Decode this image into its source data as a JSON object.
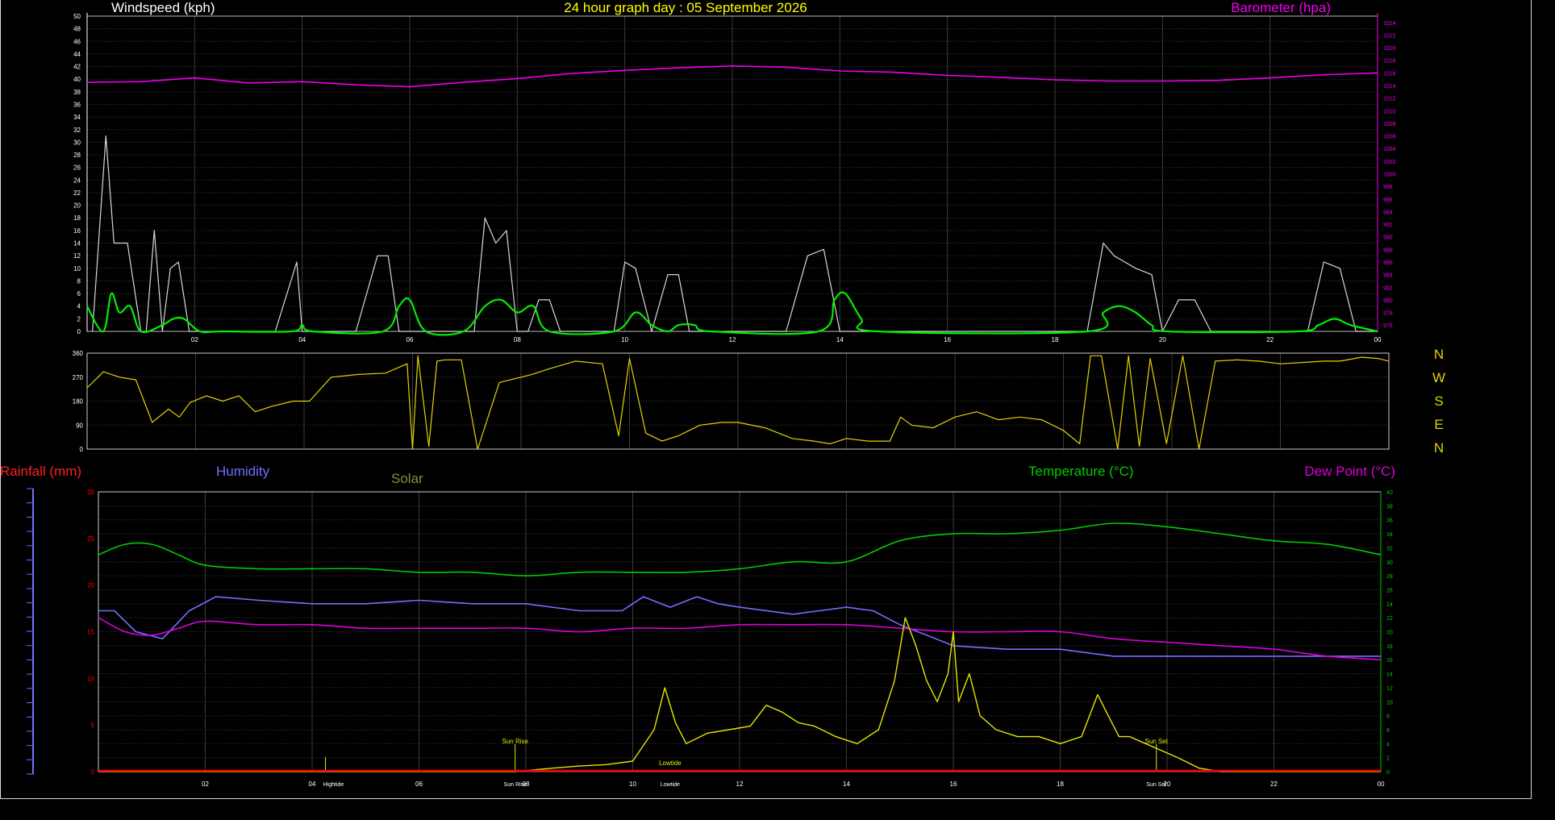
{
  "header": {
    "title": "24 hour graph day : 05 September 2026",
    "wind_label": "Windspeed (kph)",
    "baro_label": "Barometer (hpa)"
  },
  "lower_labels": {
    "rain": "Rainfall (mm)",
    "humidity": "Humidity",
    "solar": "Solar",
    "temperature": "Temperature (°C)",
    "dewpoint": "Dew Point (°C)"
  },
  "compass": [
    "N",
    "W",
    "S",
    "E",
    "N"
  ],
  "colors": {
    "title": "#ffff00",
    "wind_gust": "#d8d8d8",
    "wind_avg": "#00ee00",
    "barometer": "#ee00ee",
    "direction": "#e6d200",
    "rain": "#ff0000",
    "humidity": "#7070ff",
    "solar": "#e6e600",
    "solar_label": "#8c8c40",
    "temperature": "#00cc00",
    "dewpoint": "#dd00dd",
    "grid": "#3c3c3c"
  },
  "chart_data": [
    {
      "type": "line",
      "name": "wind-barometer",
      "x_ticks": [
        "02",
        "04",
        "06",
        "08",
        "10",
        "12",
        "14",
        "16",
        "18",
        "20",
        "22",
        "00"
      ],
      "x_range": [
        0,
        24
      ],
      "left_axis": {
        "label": "Windspeed (kph)",
        "range": [
          0,
          50
        ],
        "ticks": [
          0,
          2,
          4,
          6,
          8,
          10,
          12,
          14,
          16,
          18,
          20,
          22,
          24,
          26,
          28,
          30,
          32,
          34,
          36,
          38,
          40,
          42,
          44,
          46,
          48,
          50
        ]
      },
      "right_axis": {
        "label": "Barometer (hpa)",
        "range": [
          975,
          1025
        ],
        "ticks": [
          976,
          978,
          980,
          982,
          984,
          986,
          988,
          990,
          992,
          994,
          996,
          998,
          1000,
          1002,
          1004,
          1006,
          1008,
          1010,
          1012,
          1014,
          1016,
          1018,
          1020,
          1022,
          1024
        ]
      },
      "series": [
        {
          "name": "gust",
          "axis": "left",
          "x": [
            0.1,
            0.35,
            0.5,
            0.75,
            1.0,
            1.1,
            1.25,
            1.4,
            1.55,
            1.7,
            1.9,
            2.0,
            2.15,
            2.3,
            2.5,
            2.8,
            3.0,
            3.2,
            3.5,
            3.9,
            4.0,
            4.1,
            4.3,
            4.6,
            5.0,
            5.4,
            5.6,
            5.8,
            6.0,
            6.2,
            6.4,
            6.8,
            7.2,
            7.4,
            7.6,
            7.8,
            8.0,
            8.2,
            8.4,
            8.6,
            8.8,
            9.0,
            9.2,
            9.5,
            9.8,
            10.0,
            10.2,
            10.5,
            10.8,
            11.0,
            11.2,
            11.5,
            11.8,
            12.2,
            12.6,
            13.0,
            13.4,
            13.7,
            14.0,
            14.2,
            14.5,
            14.9,
            15.3,
            15.8,
            16.2,
            16.6,
            17.0,
            17.4,
            17.8,
            18.2,
            18.6,
            18.9,
            19.1,
            19.3,
            19.5,
            19.8,
            20.0,
            20.3,
            20.6,
            20.9,
            21.3,
            21.7,
            22.1,
            22.4,
            22.7,
            23.0,
            23.3,
            23.6,
            24.0
          ],
          "y": [
            0,
            31,
            14,
            14,
            0,
            0,
            16,
            0,
            10,
            11,
            0,
            0,
            0,
            0,
            0,
            0,
            0,
            0,
            0,
            11,
            0,
            0,
            0,
            0,
            0,
            12,
            12,
            0,
            0,
            0,
            0,
            0,
            0,
            18,
            14,
            16,
            0,
            0,
            5,
            5,
            0,
            0,
            0,
            0,
            0,
            11,
            10,
            0,
            9,
            9,
            0,
            0,
            0,
            0,
            0,
            0,
            12,
            13,
            0,
            0,
            0,
            0,
            0,
            0,
            0,
            0,
            0,
            0,
            0,
            0,
            0,
            14,
            12,
            11,
            10,
            9,
            0,
            5,
            5,
            0,
            0,
            0,
            0,
            0,
            0,
            11,
            10,
            0,
            0
          ]
        },
        {
          "name": "average",
          "axis": "left",
          "x": [
            0.0,
            0.3,
            0.45,
            0.6,
            0.8,
            1.0,
            1.4,
            1.6,
            1.8,
            2.1,
            2.5,
            3.8,
            4.0,
            4.2,
            5.5,
            5.8,
            6.0,
            6.3,
            7.0,
            7.4,
            7.7,
            8.0,
            8.3,
            8.6,
            9.8,
            10.2,
            10.5,
            10.8,
            11.0,
            11.3,
            11.6,
            13.6,
            13.9,
            14.1,
            14.4,
            14.7,
            18.6,
            18.9,
            19.2,
            19.5,
            19.8,
            20.1,
            22.5,
            22.9,
            23.2,
            23.5,
            24.0
          ],
          "y": [
            4,
            0,
            6,
            3,
            4,
            0,
            1,
            2,
            2,
            0,
            0,
            0,
            1,
            0,
            0,
            4,
            5,
            0,
            0,
            4,
            5,
            3,
            4,
            0,
            0,
            3,
            1,
            0,
            1,
            1,
            0,
            0,
            5,
            6,
            2,
            0,
            0,
            3,
            4,
            3,
            1,
            0,
            0,
            1,
            2,
            1,
            0
          ]
        },
        {
          "name": "barometer",
          "axis": "right",
          "x": [
            0,
            1,
            2,
            3,
            4,
            5,
            6,
            7,
            8,
            9,
            10,
            11,
            12,
            13,
            14,
            15,
            16,
            17,
            18,
            19,
            20,
            21,
            22,
            23,
            24
          ],
          "y": [
            1014.5,
            1014.6,
            1015.2,
            1014.4,
            1014.6,
            1014.1,
            1013.8,
            1014.5,
            1015.1,
            1015.9,
            1016.4,
            1016.8,
            1017.1,
            1016.9,
            1016.3,
            1016.1,
            1015.6,
            1015.3,
            1014.9,
            1014.7,
            1014.7,
            1014.8,
            1015.2,
            1015.7,
            1016.0
          ]
        }
      ]
    },
    {
      "type": "line",
      "name": "wind-direction",
      "y_ticks": [
        0,
        90,
        180,
        270,
        360
      ],
      "y_range": [
        0,
        360
      ],
      "x_range": [
        0,
        24
      ],
      "series": [
        {
          "name": "direction",
          "x": [
            0.0,
            0.3,
            0.6,
            0.9,
            1.2,
            1.5,
            1.7,
            1.9,
            2.2,
            2.5,
            2.8,
            3.1,
            3.4,
            3.8,
            4.1,
            4.5,
            5.0,
            5.5,
            5.9,
            6.0,
            6.1,
            6.3,
            6.45,
            6.6,
            6.9,
            7.2,
            7.6,
            7.8,
            8.0,
            8.2,
            8.5,
            9.0,
            9.5,
            9.8,
            10.0,
            10.3,
            10.6,
            10.9,
            11.3,
            11.7,
            12.0,
            12.5,
            13.0,
            13.4,
            13.7,
            14.0,
            14.4,
            14.8,
            15.0,
            15.2,
            15.6,
            16.0,
            16.4,
            16.8,
            17.2,
            17.6,
            18.0,
            18.3,
            18.5,
            18.7,
            19.0,
            19.2,
            19.4,
            19.6,
            19.9,
            20.2,
            20.5,
            20.8,
            21.2,
            21.6,
            22.0,
            22.4,
            22.8,
            23.1,
            23.5,
            23.8,
            24.0
          ],
          "y": [
            230,
            290,
            270,
            260,
            100,
            150,
            120,
            175,
            200,
            180,
            200,
            140,
            160,
            180,
            180,
            270,
            280,
            285,
            320,
            0,
            350,
            10,
            330,
            335,
            335,
            0,
            250,
            260,
            270,
            280,
            300,
            330,
            320,
            50,
            340,
            60,
            30,
            50,
            90,
            100,
            100,
            80,
            40,
            30,
            20,
            40,
            30,
            30,
            120,
            90,
            80,
            120,
            140,
            110,
            120,
            110,
            70,
            20,
            350,
            350,
            0,
            350,
            10,
            340,
            20,
            350,
            0,
            330,
            335,
            330,
            320,
            325,
            330,
            330,
            345,
            340,
            330
          ]
        }
      ]
    },
    {
      "type": "line",
      "name": "rain-temperature-humidity-solar",
      "x_ticks": [
        "02",
        "04",
        "06",
        "08",
        "10",
        "12",
        "14",
        "16",
        "18",
        "20",
        "22",
        "00"
      ],
      "x_range": [
        0,
        24
      ],
      "left_axis": {
        "label": "Rainfall (mm)",
        "range": [
          0,
          30
        ],
        "ticks": [
          0,
          5,
          10,
          15,
          20,
          25,
          30
        ]
      },
      "right_axis": {
        "label": "Temperature (°C)",
        "range": [
          0,
          40
        ],
        "ticks": [
          0,
          2,
          4,
          6,
          8,
          10,
          12,
          14,
          16,
          18,
          20,
          22,
          24,
          26,
          28,
          30,
          32,
          34,
          36,
          38,
          40
        ]
      },
      "annotations": [
        {
          "text": "Sun Rise",
          "x": 7.8
        },
        {
          "text": "Sun Set",
          "x": 19.8
        },
        {
          "text": "Lowtide",
          "x": 10.7
        },
        {
          "text": "Hightide",
          "x": 4.4
        }
      ],
      "series": [
        {
          "name": "temperature",
          "axis": "right",
          "x": [
            0,
            0.5,
            1,
            1.5,
            2,
            3,
            4,
            5,
            6,
            7,
            8,
            9,
            10,
            11,
            12,
            13,
            14,
            15,
            16,
            17,
            18,
            19,
            20,
            21,
            22,
            23,
            24
          ],
          "y": [
            31,
            32.5,
            32.5,
            31,
            29.5,
            29,
            29,
            29,
            28.5,
            28.5,
            28,
            28.5,
            28.5,
            28.5,
            29,
            30,
            30,
            33,
            34,
            34,
            34.5,
            35.5,
            35,
            34,
            33,
            32.5,
            31
          ]
        },
        {
          "name": "humidity",
          "axis": "right",
          "x": [
            0,
            0.3,
            0.7,
            1.2,
            1.7,
            2.2,
            3,
            4,
            5,
            6,
            7,
            8,
            9,
            9.8,
            10.2,
            10.7,
            11.2,
            11.6,
            12,
            13,
            14,
            14.5,
            15,
            15.5,
            16,
            17,
            18,
            19,
            20,
            21,
            22,
            23,
            24
          ],
          "y": [
            23,
            23,
            20,
            19,
            23,
            25,
            24.5,
            24,
            24,
            24.5,
            24,
            24,
            23,
            23,
            25,
            23.5,
            25,
            24,
            23.5,
            22.5,
            23.5,
            23,
            21,
            19.5,
            18,
            17.5,
            17.5,
            16.5,
            16.5,
            16.5,
            16.5,
            16.5,
            16.5
          ]
        },
        {
          "name": "dewpoint",
          "axis": "right",
          "x": [
            0,
            0.5,
            1,
            1.5,
            2,
            3,
            4,
            5,
            6,
            7,
            8,
            9,
            10,
            11,
            12,
            13,
            14,
            15,
            16,
            17,
            18,
            19,
            20,
            21,
            22,
            23,
            24
          ],
          "y": [
            22,
            20,
            19.5,
            20.5,
            21.5,
            21,
            21,
            20.5,
            20.5,
            20.5,
            20.5,
            20,
            20.5,
            20.5,
            21,
            21,
            21,
            20.5,
            20,
            20,
            20,
            19,
            18.5,
            18,
            17.5,
            16.5,
            16
          ]
        },
        {
          "name": "solar",
          "axis": "right",
          "x": [
            0,
            7.8,
            8.5,
            9.0,
            9.5,
            10.0,
            10.4,
            10.6,
            10.8,
            11.0,
            11.4,
            11.8,
            12.2,
            12.5,
            12.8,
            13.1,
            13.4,
            13.8,
            14.2,
            14.6,
            14.9,
            15.1,
            15.3,
            15.5,
            15.7,
            15.9,
            16.0,
            16.1,
            16.3,
            16.5,
            16.8,
            17.2,
            17.6,
            18.0,
            18.4,
            18.7,
            18.9,
            19.1,
            19.3,
            19.6,
            19.9,
            20.2,
            20.6,
            21.0,
            24.0
          ],
          "y": [
            0,
            0,
            0.5,
            0.8,
            1,
            1.5,
            6,
            12,
            7,
            4,
            5.5,
            6,
            6.5,
            9.5,
            8.5,
            7,
            6.5,
            5,
            4,
            6,
            13,
            22,
            18,
            13,
            10,
            14,
            20,
            10,
            14,
            8,
            6,
            5,
            5,
            4,
            5,
            11,
            8,
            5,
            5,
            4,
            3,
            2,
            0.5,
            0,
            0
          ]
        },
        {
          "name": "rainfall",
          "axis": "left",
          "x": [
            0,
            24
          ],
          "y": [
            0,
            0
          ]
        }
      ]
    }
  ]
}
